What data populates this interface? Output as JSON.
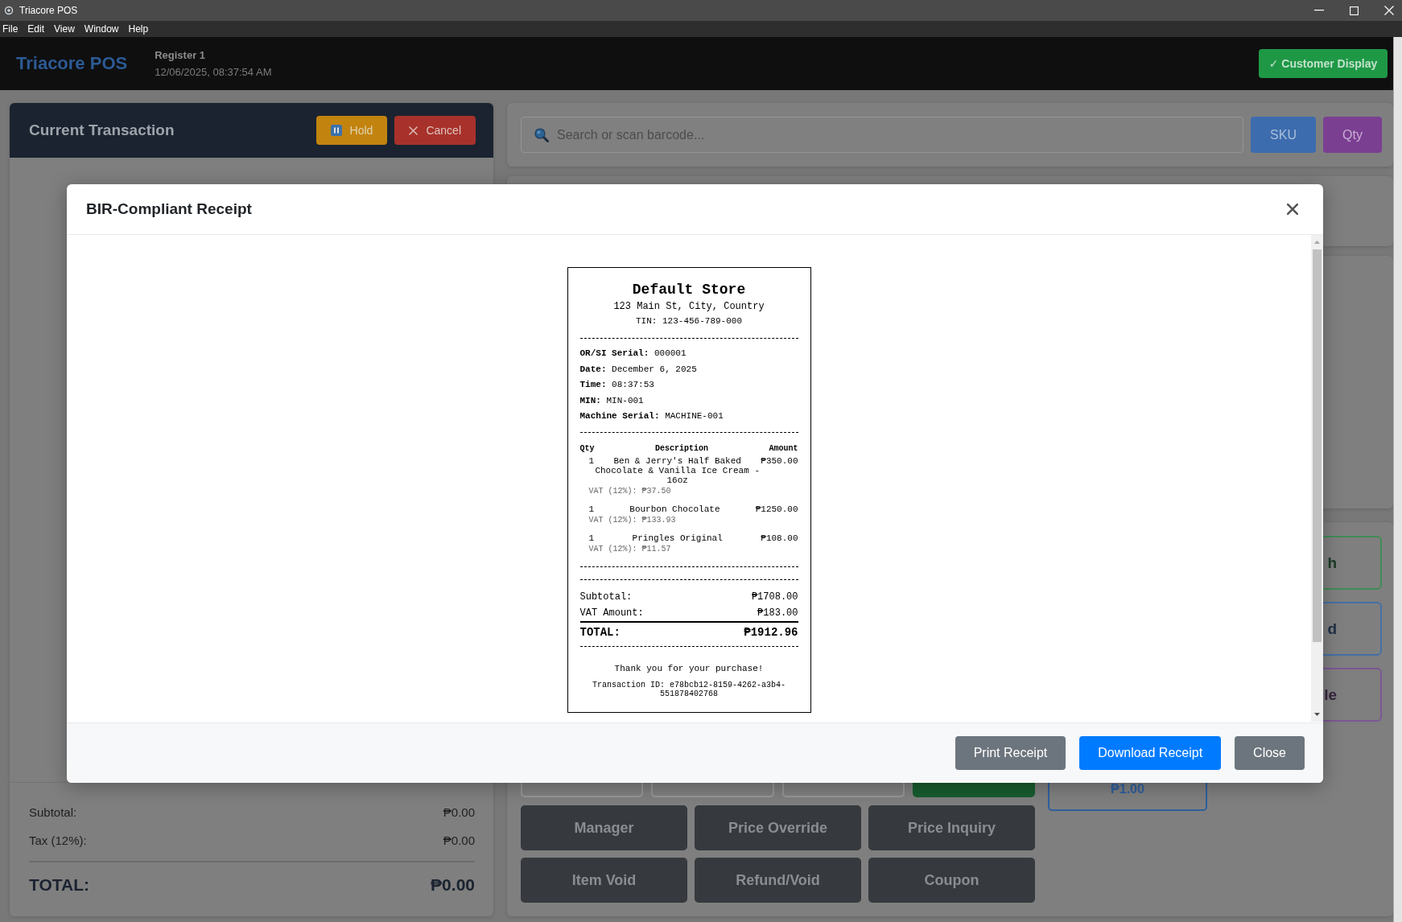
{
  "window": {
    "title": "Triacore POS"
  },
  "menu_bar": [
    "File",
    "Edit",
    "View",
    "Window",
    "Help"
  ],
  "header": {
    "logo": "Triacore POS",
    "register": "Register 1",
    "datetime": "12/06/2025, 08:37:54 AM",
    "customer_display_button": "✓ Customer Display"
  },
  "transaction_panel": {
    "title": "Current Transaction",
    "actions": [
      {
        "kind": "hold",
        "label": "Hold"
      },
      {
        "kind": "cancel",
        "label": "Cancel"
      }
    ],
    "summary": [
      {
        "label": "Subtotal:",
        "value": "₱0.00"
      },
      {
        "label": "Tax (12%):",
        "value": "₱0.00"
      }
    ],
    "total": {
      "label": "TOTAL:",
      "value": "₱0.00"
    }
  },
  "search": {
    "placeholder": "Search or scan barcode...",
    "buttons": [
      {
        "kind": "sku",
        "label": "SKU"
      },
      {
        "kind": "qty",
        "label": "Qty"
      }
    ]
  },
  "keypad_row": [
    {
      "kind": "outline"
    },
    {
      "kind": "outline"
    },
    {
      "kind": "outline"
    },
    {
      "kind": "confirm"
    }
  ],
  "function_buttons": [
    "Manager",
    "Price Override",
    "Price Inquiry",
    "Item Void",
    "Refund/Void",
    "Coupon"
  ],
  "quick_amounts": [
    "₱1.00"
  ],
  "payment_buttons": [
    {
      "label": "h",
      "color": "#3f8b55"
    },
    {
      "label": "d",
      "color": "#4470a6"
    },
    {
      "label": "le",
      "color": "#7d5694"
    }
  ],
  "receipt_dialog": {
    "title": "BIR-Compliant Receipt",
    "receipt": {
      "store_name": "Default Store",
      "address": "123 Main St, City, Country",
      "tin": "TIN: 123-456-789-000",
      "details": [
        "**OR/SI Serial:** 000001",
        "**Date:** December 6, 2025",
        "**Time:** 08:37:53",
        "**MIN:** MIN-001",
        "**Machine Serial:** MACHINE-001"
      ],
      "columns": [
        "Qty",
        "Description",
        "Amount"
      ],
      "items": [
        {
          "qty": "1",
          "description": "Ben & Jerry's Half Baked Chocolate & Vanilla Ice Cream - 16oz",
          "amount": "₱350.00",
          "vat": "VAT (12%): ₱37.50"
        },
        {
          "qty": "1",
          "description": "Bourbon Chocolate",
          "amount": "₱1250.00",
          "vat": "VAT (12%): ₱133.93"
        },
        {
          "qty": "1",
          "description": "Pringles Original",
          "amount": "₱108.00",
          "vat": "VAT (12%): ₱11.57"
        }
      ],
      "subtotal": {
        "label": "Subtotal:",
        "value": "₱1708.00"
      },
      "vat_amount": {
        "label": "VAT Amount:",
        "value": "₱183.00"
      },
      "total": {
        "label": "TOTAL:",
        "value": "₱1912.96"
      },
      "thank_you": "Thank you for your purchase!",
      "transaction_id": "Transaction ID: e78bcb12-8159-4262-a3b4-551878402768"
    },
    "buttons": [
      {
        "kind": "secondary",
        "label": "Print Receipt"
      },
      {
        "kind": "primary",
        "label": "Download Receipt"
      },
      {
        "kind": "secondary",
        "label": "Close"
      }
    ]
  }
}
